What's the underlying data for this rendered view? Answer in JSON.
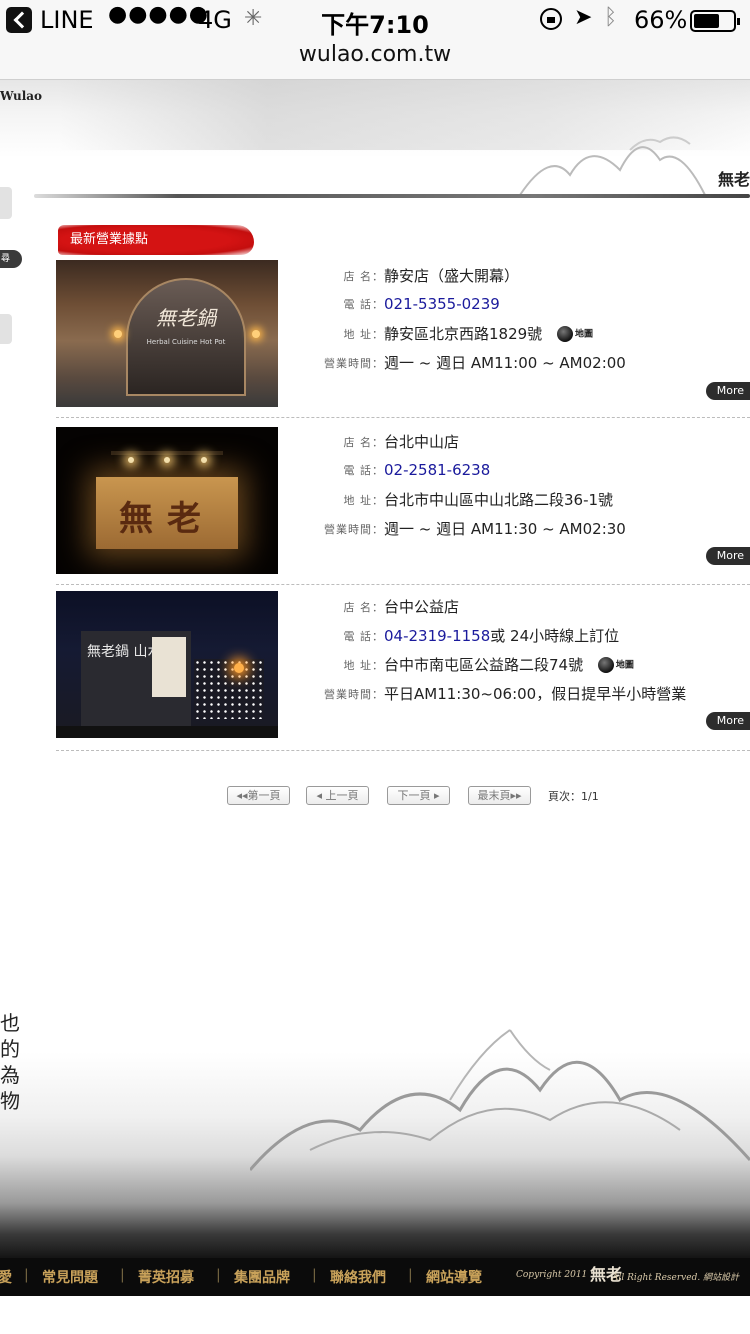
{
  "statusbar": {
    "carrier": "LINE",
    "signal": "●●●●●",
    "network": "4G",
    "time": "下午7:10",
    "battery_text": "66%",
    "battery_level": 0.66
  },
  "browser": {
    "url": "wulao.com.tw"
  },
  "header": {
    "brand": "Wulao",
    "logo_right": "無老"
  },
  "sidebar": {
    "tag": "尋"
  },
  "section_title": "最新營業據點",
  "labels": {
    "name": "店 名：",
    "phone": "電 話：",
    "address": "地 址：",
    "hours": "營業時間："
  },
  "map_label": "地圖",
  "more_label": "More",
  "stores": [
    {
      "photo_text": "無老鍋",
      "photo_subtext": "Herbal Cuisine Hot Pot",
      "name": "静安店（盛大開幕）",
      "phone": "021-5355-0239",
      "phone_suffix": "",
      "address": "静安區北京西路1829號",
      "hours": "週一 ~ 週日 AM11:00 ~ AM02:00"
    },
    {
      "photo_text": "無老",
      "name": "台北中山店",
      "phone": "02-2581-6238",
      "phone_suffix": "",
      "address": "台北市中山區中山北路二段36-1號",
      "hours": "週一 ~ 週日 AM11:30 ~ AM02:30"
    },
    {
      "photo_text": "無老鍋 山水",
      "name": "台中公益店",
      "phone": "04-2319-1158",
      "phone_suffix": " 或 24小時線上訂位",
      "address": "台中市南屯區公益路二段74號",
      "hours": "平日AM11:30~06:00，假日提早半小時營業"
    }
  ],
  "pager": {
    "first": "第一頁",
    "prev": "上一頁",
    "next": "下一頁",
    "last": "最末頁",
    "info": "頁次：1/1"
  },
  "footer_art": {
    "calligraphy": "也的為物"
  },
  "footer": {
    "nav": [
      "愛",
      "常見問題",
      "菁英招募",
      "集團品牌",
      "聯絡我們",
      "網站導覽"
    ],
    "copyright": "Copyright 2011",
    "mark": "無老",
    "rights": "All Right Reserved.  網站設計"
  }
}
